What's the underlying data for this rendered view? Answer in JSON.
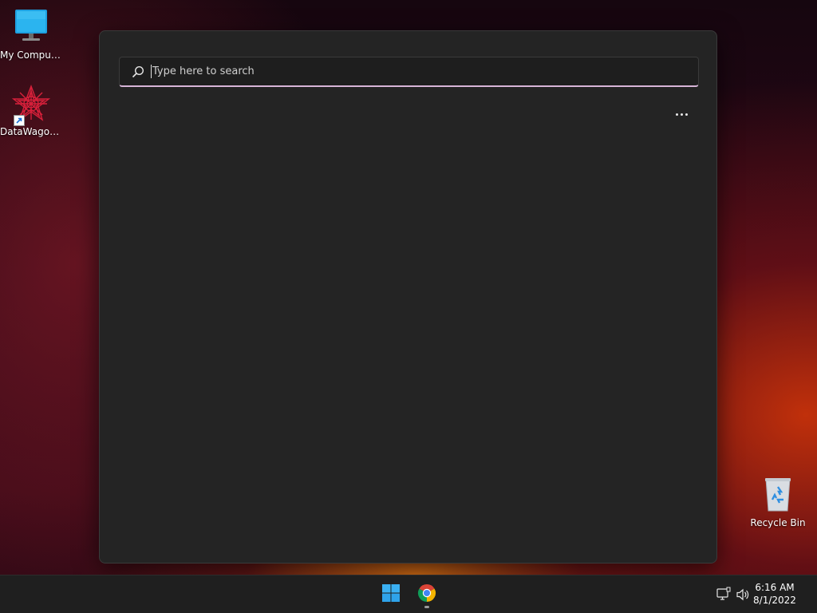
{
  "desktop": {
    "icons": [
      {
        "label": "My Computer",
        "icon": "monitor-icon"
      },
      {
        "label": "DataWagon...",
        "icon": "datawagon-app-icon",
        "shortcut": true
      },
      {
        "label": "Recycle Bin",
        "icon": "recycle-bin-icon"
      }
    ]
  },
  "search_panel": {
    "placeholder": "Type here to search",
    "value": "",
    "more_options_icon": "ellipsis-icon",
    "accent_color": "#d7b5d8"
  },
  "taskbar": {
    "start_icon": "windows-start-icon",
    "pinned": [
      {
        "name": "Google Chrome",
        "icon": "chrome-icon",
        "running": true
      }
    ],
    "tray": {
      "network_icon": "network-icon",
      "volume_icon": "volume-icon",
      "time": "6:16 AM",
      "date": "8/1/2022"
    },
    "accent_color": "#0078d4"
  }
}
